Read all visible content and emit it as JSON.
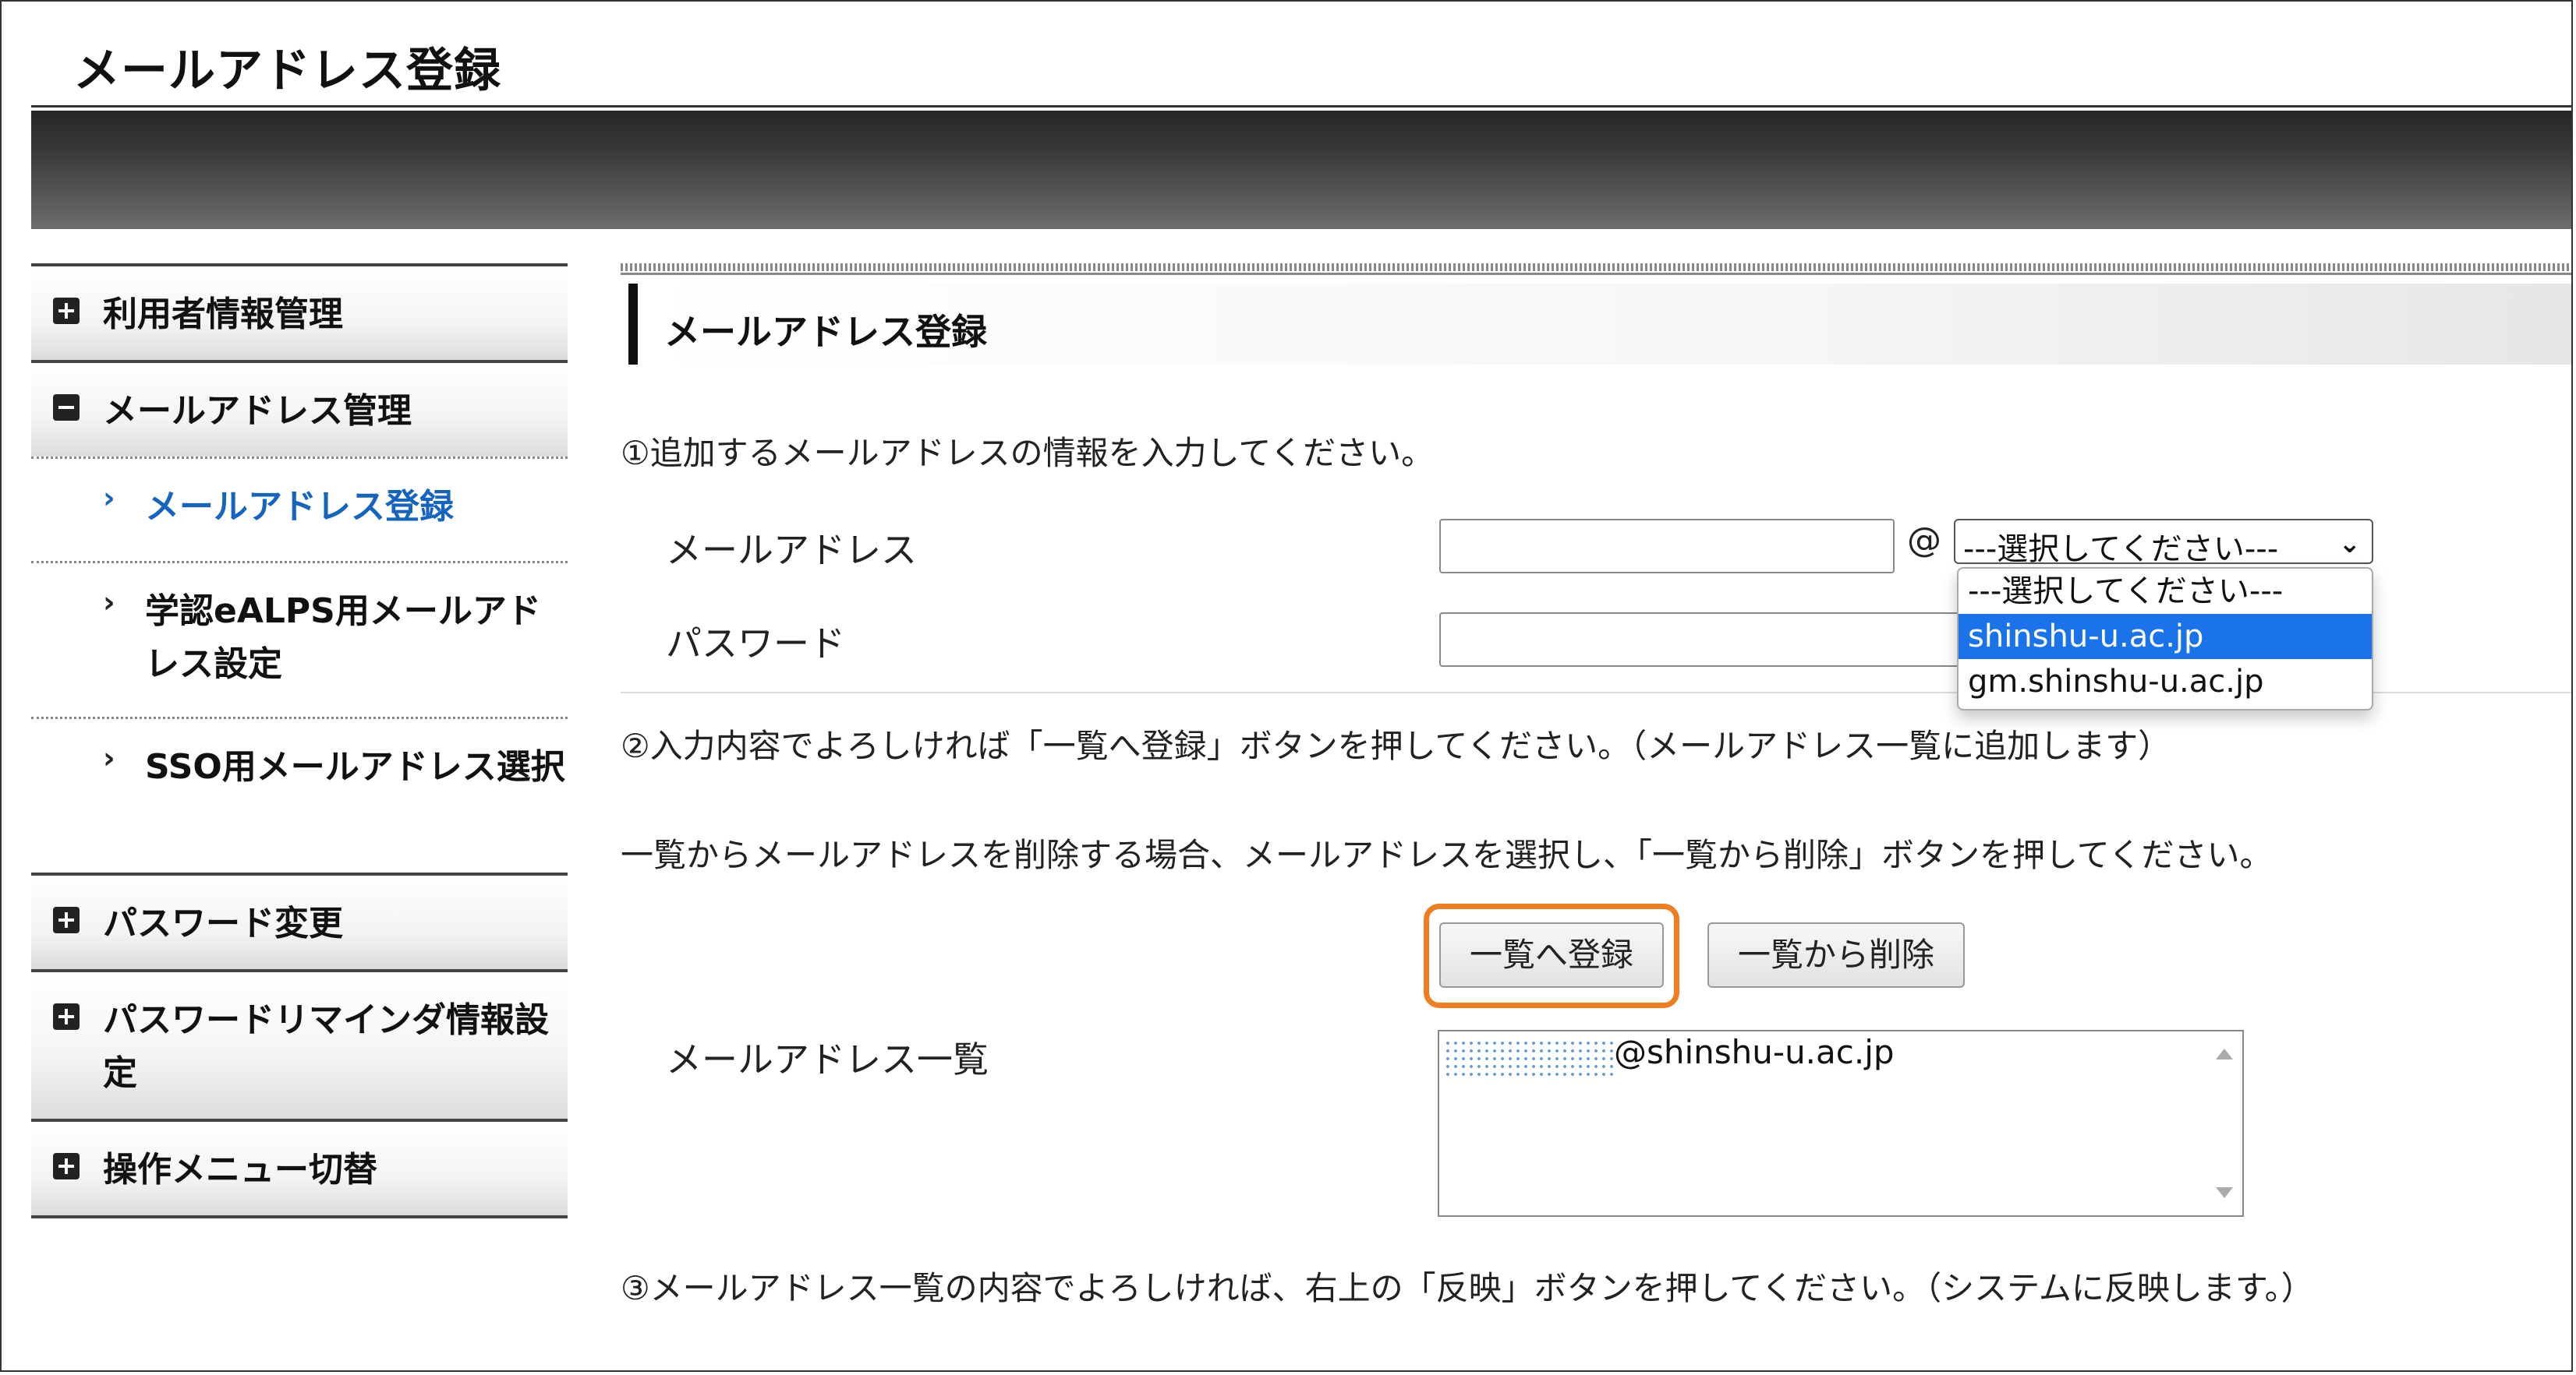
{
  "page": {
    "title": "メールアドレス登録"
  },
  "sidebar": {
    "categories": [
      {
        "label": "利用者情報管理",
        "expanded": false
      },
      {
        "label": "メールアドレス管理",
        "expanded": true
      },
      {
        "label": "パスワード変更",
        "expanded": false
      },
      {
        "label": "パスワードリマインダ情報設定",
        "expanded": false
      },
      {
        "label": "操作メニュー切替",
        "expanded": false
      }
    ],
    "sub_items": [
      {
        "label": "メールアドレス登録",
        "active": true
      },
      {
        "label": "学認eALPS用メールアドレス設定",
        "active": false
      },
      {
        "label": "SSO用メールアドレス選択",
        "active": false
      }
    ]
  },
  "main": {
    "section_title": "メールアドレス登録",
    "step1": "①追加するメールアドレスの情報を入力してください。",
    "email_label": "メールアドレス",
    "password_label": "パスワード",
    "at_sign": "@",
    "domain_select": {
      "selected": "---選択してください---",
      "options": [
        "---選択してください---",
        "shinshu-u.ac.jp",
        "gm.shinshu-u.ac.jp"
      ],
      "highlighted_option": "shinshu-u.ac.jp"
    },
    "step2": "②入力内容でよろしければ「一覧へ登録」ボタンを押してください。（メールアドレス一覧に追加します）",
    "delete_note": "一覧からメールアドレスを削除する場合、メールアドレスを選択し、「一覧から削除」ボタンを押してください。",
    "register_button": "一覧へ登録",
    "delete_button": "一覧から削除",
    "list_label": "メールアドレス一覧",
    "list_items": [
      "@shinshu-u.ac.jp"
    ],
    "step3": "③メールアドレス一覧の内容でよろしければ、右上の「反映」ボタンを押してください。（システムに反映します。）"
  },
  "colors": {
    "active_link": "#1565c0",
    "highlight_ring": "#ef7d22",
    "dropdown_selected": "#1a73e8"
  }
}
